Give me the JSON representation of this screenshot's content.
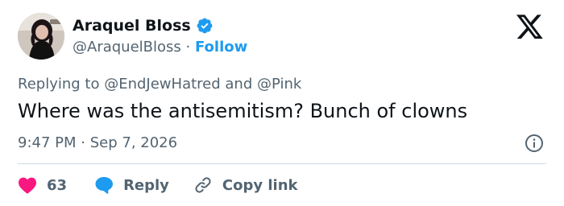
{
  "author": {
    "name": "Araquel Bloss",
    "handle": "@AraquelBloss",
    "separator": "·",
    "follow_label": "Follow",
    "verified_color": "#1d9bf0"
  },
  "reply_context": {
    "prefix": "Replying to",
    "mention_1": "@EndJewHatred",
    "conjunction": "and",
    "mention_2": "@Pink"
  },
  "tweet": {
    "text": "Where was the antisemitism? Bunch of clowns",
    "time": "9:47 PM",
    "separator": "·",
    "date": "Sep 7, 2026"
  },
  "actions": {
    "like_count": "63",
    "like_color": "#f91880",
    "reply_label": "Reply",
    "reply_color": "#1d9bf0",
    "copy_link_label": "Copy link"
  },
  "icons": [
    "verified-badge-icon",
    "x-logo-icon",
    "info-icon",
    "heart-icon",
    "reply-bubble-icon",
    "link-icon"
  ]
}
